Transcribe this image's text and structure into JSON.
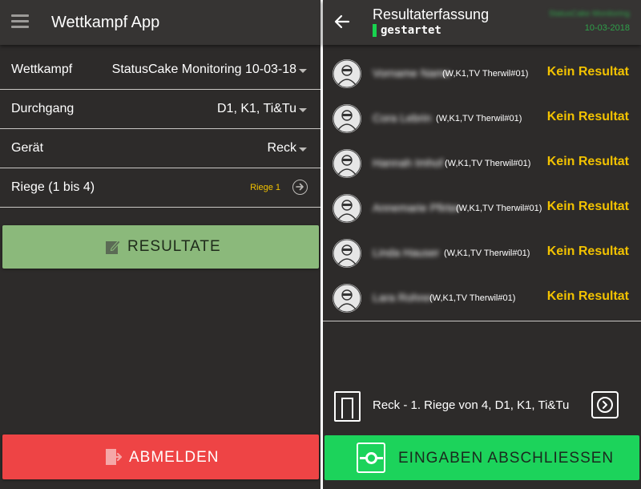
{
  "left": {
    "header": {
      "title": "Wettkampf App",
      "menu_icon": "hamburger-menu-icon"
    },
    "fields": [
      {
        "label": "Wettkampf",
        "value": "StatusCake Monitoring 10-03-18"
      },
      {
        "label": "Durchgang",
        "value": "D1, K1, Ti&Tu"
      },
      {
        "label": "Gerät",
        "value": "Reck"
      },
      {
        "label": "Riege (1 bis 4)",
        "value": "Riege 1"
      }
    ],
    "resultate_button": {
      "label": "RESULTATE",
      "icon": "edit-icon",
      "color": "#8bb97b"
    },
    "abmelden_button": {
      "label": "ABMELDEN",
      "icon": "logout-icon",
      "color": "#ee4445"
    }
  },
  "right": {
    "header": {
      "title": "Resultaterfassung",
      "status": "gestartet",
      "status_color": "#18d34f",
      "event": "StatusCake Monitoring",
      "date": "10-03-2018"
    },
    "athletes": [
      {
        "name": "Vorname Name",
        "club": "(W,K1,TV Therwil#01)",
        "result": "Kein Resultat"
      },
      {
        "name": "Cora Lebrin",
        "club": "(W,K1,TV Therwil#01)",
        "result": "Kein Resultat"
      },
      {
        "name": "Hannah Imhof",
        "club": "(W,K1,TV Therwil#01)",
        "result": "Kein Resultat"
      },
      {
        "name": "Annemarie Pfirter",
        "club": "(W,K1,TV Therwil#01)",
        "result": "Kein Resultat"
      },
      {
        "name": "Linda Hauser",
        "club": "(W,K1,TV Therwil#01)",
        "result": "Kein Resultat"
      },
      {
        "name": "Lara Rohrer",
        "club": "(W,K1,TV Therwil#01)",
        "result": "Kein Resultat"
      }
    ],
    "footer": {
      "text": "Reck - 1. Riege von 4, D1, K1, Ti&Tu",
      "icon": "door-icon",
      "next_icon": "arrow-right-circle-icon"
    },
    "eingaben_button": {
      "label": "EINGABEN ABSCHLIESSEN",
      "icon": "lock-icon",
      "color": "#1cd35b"
    }
  }
}
